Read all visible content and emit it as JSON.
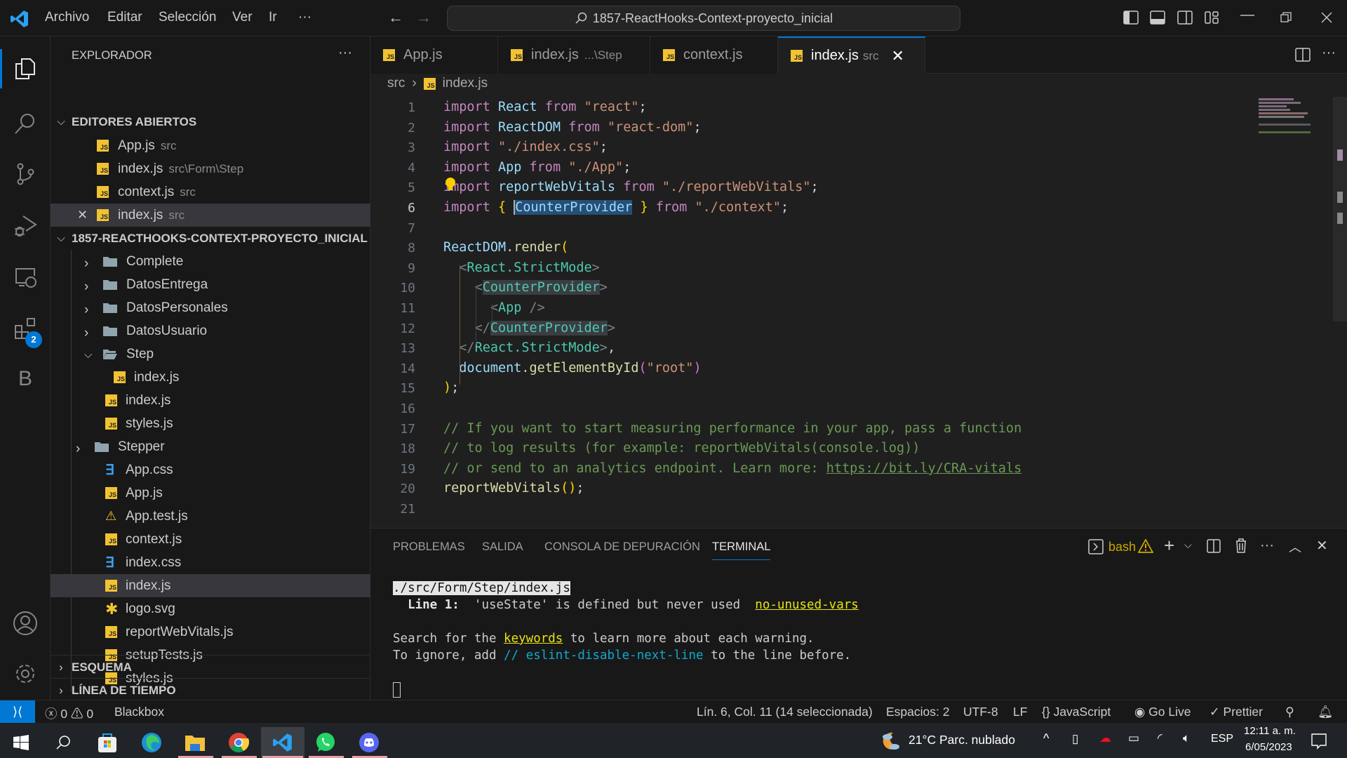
{
  "titlebar": {
    "menu": [
      "Archivo",
      "Editar",
      "Selección",
      "Ver",
      "Ir",
      "···"
    ],
    "search": "1857-ReactHooks-Context-proyecto_inicial"
  },
  "activity": {
    "items": [
      "explorer",
      "search",
      "source-control",
      "run-debug",
      "remote-explorer",
      "extensions",
      "blackbox"
    ],
    "extensions_badge": "2",
    "blackbox_label": "B"
  },
  "sidebar": {
    "title": "EXPLORADOR",
    "more": "···",
    "open_editors_header": "EDITORES ABIERTOS",
    "open_editors": [
      {
        "name": "App.js",
        "desc": "src"
      },
      {
        "name": "index.js",
        "desc": "src\\Form\\Step"
      },
      {
        "name": "context.js",
        "desc": "src"
      },
      {
        "name": "index.js",
        "desc": "src"
      }
    ],
    "project_header": "1857-REACTHOOKS-CONTEXT-PROYECTO_INICIAL",
    "tree": [
      {
        "name": "Complete",
        "type": "folder"
      },
      {
        "name": "DatosEntrega",
        "type": "folder"
      },
      {
        "name": "DatosPersonales",
        "type": "folder"
      },
      {
        "name": "DatosUsuario",
        "type": "folder"
      },
      {
        "name": "Step",
        "type": "folder-open"
      },
      {
        "name": "index.js",
        "type": "js"
      },
      {
        "name": "index.js",
        "type": "js"
      },
      {
        "name": "styles.js",
        "type": "js"
      },
      {
        "name": "Stepper",
        "type": "folder"
      },
      {
        "name": "App.css",
        "type": "css"
      },
      {
        "name": "App.js",
        "type": "js"
      },
      {
        "name": "App.test.js",
        "type": "test"
      },
      {
        "name": "context.js",
        "type": "js"
      },
      {
        "name": "index.css",
        "type": "css"
      },
      {
        "name": "index.js",
        "type": "js"
      },
      {
        "name": "logo.svg",
        "type": "svg"
      },
      {
        "name": "reportWebVitals.js",
        "type": "js"
      },
      {
        "name": "setupTests.js",
        "type": "js"
      },
      {
        "name": "styles.js",
        "type": "js"
      }
    ],
    "outline": "ESQUEMA",
    "timeline": "LÍNEA DE TIEMPO"
  },
  "tabs": [
    {
      "name": "App.js",
      "desc": ""
    },
    {
      "name": "index.js",
      "desc": "...\\Step"
    },
    {
      "name": "context.js",
      "desc": ""
    },
    {
      "name": "index.js",
      "desc": "src",
      "active": true
    }
  ],
  "breadcrumb": {
    "folder": "src",
    "file": "index.js"
  },
  "editor": {
    "current_line": 6,
    "lines": [
      "import React from \"react\";",
      "import ReactDOM from \"react-dom\";",
      "import \"./index.css\";",
      "import App from \"./App\";",
      "import reportWebVitals from \"./reportWebVitals\";",
      "import { CounterProvider } from \"./context\";",
      "",
      "ReactDOM.render(",
      "  <React.StrictMode>",
      "    <CounterProvider>",
      "      <App />",
      "    </CounterProvider>",
      "  </React.StrictMode>,",
      "  document.getElementById(\"root\")",
      ");",
      "",
      "// If you want to start measuring performance in your app, pass a function",
      "// to log results (for example: reportWebVitals(console.log))",
      "// or send to an analytics endpoint. Learn more: https://bit.ly/CRA-vitals",
      "reportWebVitals();",
      ""
    ]
  },
  "panel": {
    "tabs": [
      "PROBLEMAS",
      "SALIDA",
      "CONSOLA DE DEPURACIÓN",
      "TERMINAL"
    ],
    "active_tab": "TERMINAL",
    "shell": "bash",
    "terminal": {
      "file": "./src/Form/Step/index.js",
      "line_label": "Line 1:",
      "message": "'useState' is defined but never used",
      "rule": "no-unused-vars",
      "search_pre": "Search for the ",
      "search_kw": "keywords",
      "search_post": " to learn more about each warning.",
      "ignore_pre": "To ignore, add ",
      "ignore_code": "// eslint-disable-next-line",
      "ignore_post": " to the line before."
    }
  },
  "status": {
    "errors": "0",
    "warnings": "0",
    "blackbox": "Blackbox",
    "position": "Lín. 6, Col. 11 (14 seleccionada)",
    "spaces": "Espacios: 2",
    "encoding": "UTF-8",
    "eol": "LF",
    "language": "JavaScript",
    "golive": "Go Live",
    "prettier": "Prettier"
  },
  "taskbar": {
    "apps": [
      "start",
      "search",
      "microsoft-store",
      "edge",
      "file-explorer",
      "chrome",
      "vscode",
      "whatsapp",
      "discord"
    ],
    "weather": "21°C  Parc. nublado",
    "lang": "ESP",
    "time": "12:11 a. m.",
    "date": "6/05/2023"
  },
  "colors": {
    "accent": "#0078d4",
    "js_icon": "#f1c232",
    "css_icon": "#3f9ce8",
    "warning": "#cca700"
  }
}
